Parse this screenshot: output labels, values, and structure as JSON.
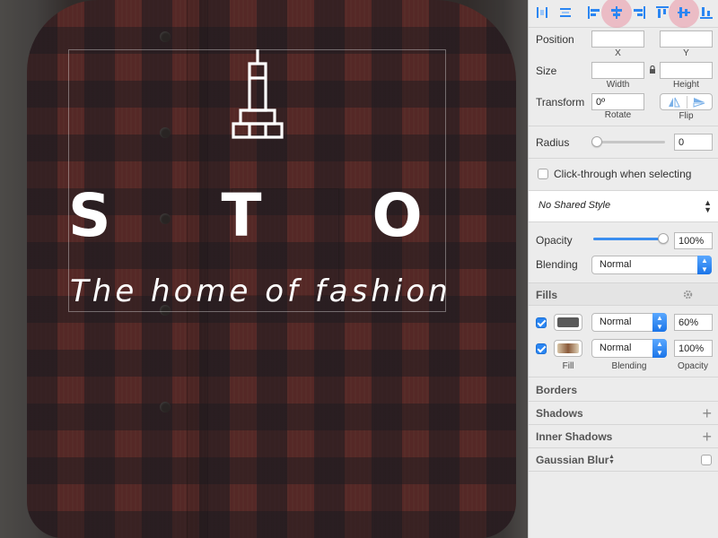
{
  "canvas": {
    "title": "S T O R E",
    "tagline": "The home of fashion"
  },
  "align_bar": {
    "icons": [
      "distribute-horizontal-icon",
      "distribute-vertical-icon",
      "align-left-icon",
      "align-center-horizontal-icon",
      "align-right-icon",
      "align-top-icon",
      "align-center-vertical-icon",
      "align-bottom-icon"
    ]
  },
  "position": {
    "label": "Position",
    "x_label": "X",
    "y_label": "Y",
    "x_value": "",
    "y_value": ""
  },
  "size": {
    "label": "Size",
    "width_label": "Width",
    "height_label": "Height",
    "width_value": "",
    "height_value": ""
  },
  "transform": {
    "label": "Transform",
    "rotate_value": "0º",
    "rotate_label": "Rotate",
    "flip_label": "Flip"
  },
  "radius": {
    "label": "Radius",
    "value": "0"
  },
  "click_through": {
    "label": "Click-through when selecting",
    "checked": false
  },
  "shared_style": {
    "value": "No Shared Style"
  },
  "opacity": {
    "label": "Opacity",
    "value": "100%",
    "level": 1.0
  },
  "blending": {
    "label": "Blending",
    "value": "Normal"
  },
  "fills": {
    "label": "Fills",
    "rows": [
      {
        "checked": true,
        "blending": "Normal",
        "opacity": "60%",
        "swatch": "#5a5a5a"
      },
      {
        "checked": true,
        "blending": "Normal",
        "opacity": "100%",
        "swatch": "image"
      }
    ],
    "col_fill": "Fill",
    "col_blending": "Blending",
    "col_opacity": "Opacity"
  },
  "borders": {
    "label": "Borders"
  },
  "shadows": {
    "label": "Shadows"
  },
  "inner_shadows": {
    "label": "Inner Shadows"
  },
  "gaussian_blur": {
    "label": "Gaussian Blur"
  },
  "colors": {
    "accent": "#2b86f2",
    "highlight": "#ec8296"
  }
}
